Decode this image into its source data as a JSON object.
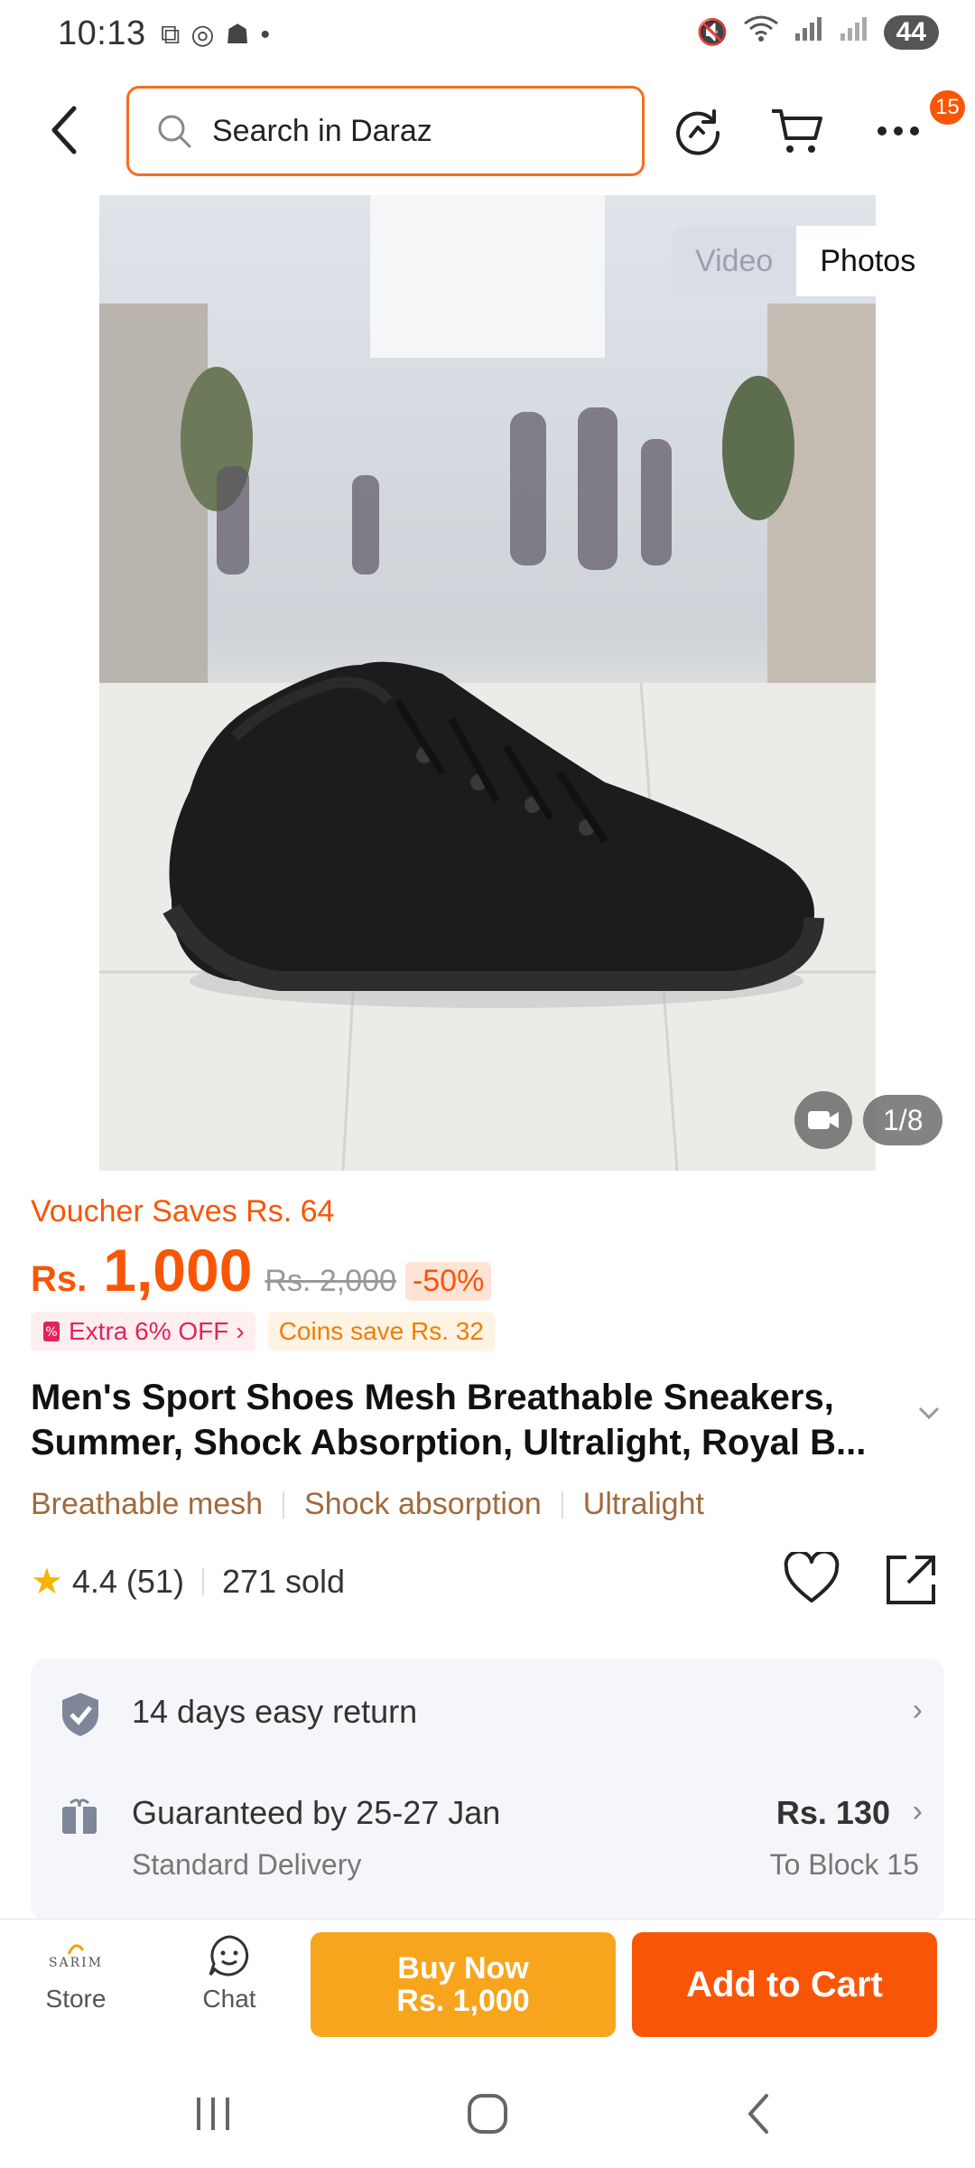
{
  "status_bar": {
    "time": "10:13",
    "battery": "44"
  },
  "search": {
    "placeholder": "Search in Daraz"
  },
  "header": {
    "more_badge": "15"
  },
  "gallery": {
    "tab_video": "Video",
    "tab_photos": "Photos",
    "counter": "1/8"
  },
  "pricing": {
    "voucher": "Voucher Saves Rs. 64",
    "currency": "Rs.",
    "price": "1,000",
    "old_price": "Rs. 2,000",
    "discount": "-50%",
    "promo": "Extra 6% OFF",
    "coins": "Coins save Rs. 32"
  },
  "product": {
    "title": "Men's Sport Shoes Mesh Breathable Sneakers, Summer, Shock Absorption, Ultralight, Royal B...",
    "tags": [
      "Breathable mesh",
      "Shock absorption",
      "Ultralight"
    ],
    "rating": "4.4 (51)",
    "sold": "271 sold"
  },
  "services": {
    "return": "14 days easy return",
    "delivery": "Guaranteed by 25-27 Jan",
    "delivery_type": "Standard Delivery",
    "delivery_price": "Rs. 130",
    "delivery_to": "To Block 15"
  },
  "action_bar": {
    "store_label": "Store",
    "store_logo": "SARIM",
    "chat_label": "Chat",
    "buy_now_line1": "Buy Now",
    "buy_now_line2": "Rs. 1,000",
    "add_to_cart": "Add to Cart"
  },
  "colors": {
    "accent": "#f85606",
    "buy_now": "#f8a51e"
  }
}
